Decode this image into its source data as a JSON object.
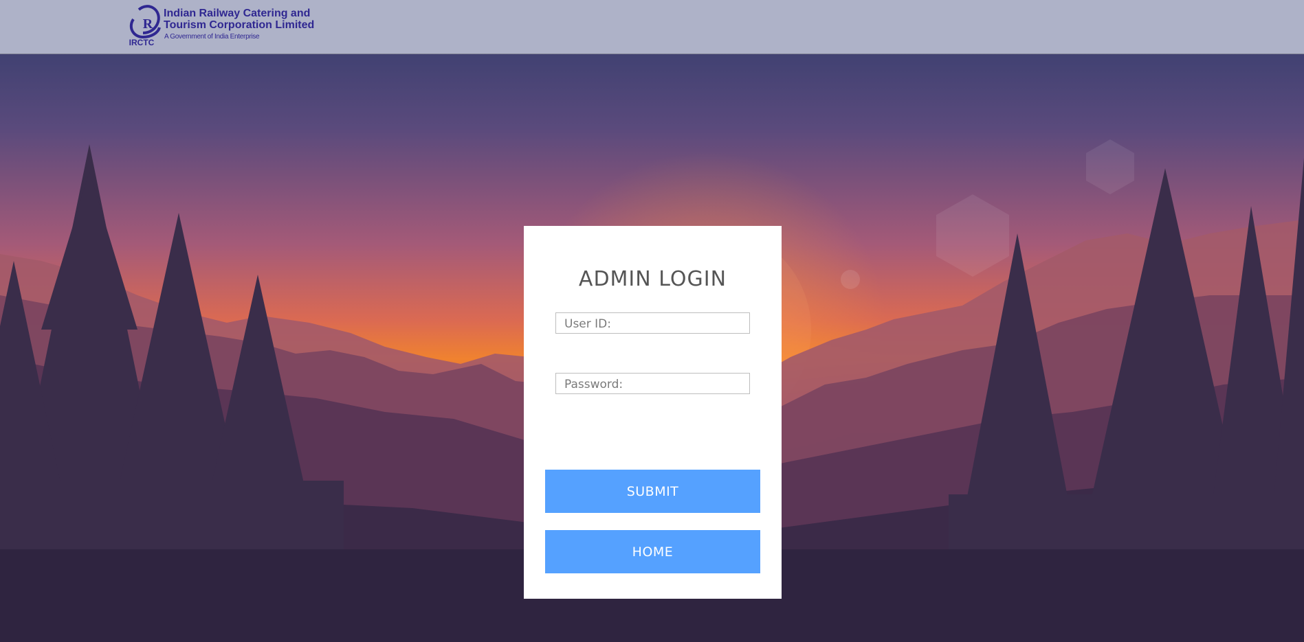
{
  "header": {
    "logo_text": "IRCTC",
    "logo_glyph": "R",
    "org_line1": "Indian Railway Catering and",
    "org_line2": "Tourism Corporation Limited",
    "org_tagline": "A Government of India Enterprise"
  },
  "login": {
    "title": "ADMIN LOGIN",
    "user_placeholder": "User ID:",
    "user_value": "",
    "password_placeholder": "Password:",
    "password_value": "",
    "submit_label": "SUBMIT",
    "home_label": "HOME"
  },
  "colors": {
    "header_bg": "#aeb2c8",
    "brand_text": "#2f2791",
    "button_bg": "#55a1ff",
    "button_text": "#ffffff",
    "card_bg": "#ffffff",
    "title_text": "#555555"
  },
  "icons": {
    "logo": "irctc-logo-icon"
  }
}
